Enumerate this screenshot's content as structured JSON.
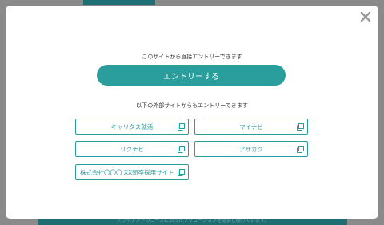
{
  "background": {
    "footer_text": "クライアントのニーズに沿ったソリューションを提供し続けています。"
  },
  "modal": {
    "close_icon": "close-icon",
    "lead_text": "このサイトから直接エントリーできます",
    "entry_button_label": "エントリーする",
    "sub_lead_text": "以下の外部サイトからもエントリーできます",
    "external_sites": [
      {
        "label": "キャリタス就活",
        "icon": "external-link-icon"
      },
      {
        "label": "マイナビ",
        "icon": "external-link-icon"
      },
      {
        "label": "リクナビ",
        "icon": "external-link-icon"
      },
      {
        "label": "アサガク",
        "icon": "external-link-icon"
      },
      {
        "label": "株式会社〇〇〇 XX新卒採用サイト",
        "icon": "external-link-icon"
      }
    ]
  },
  "colors": {
    "accent": "#2a9d9d",
    "overlay": "#8a8a8a"
  }
}
